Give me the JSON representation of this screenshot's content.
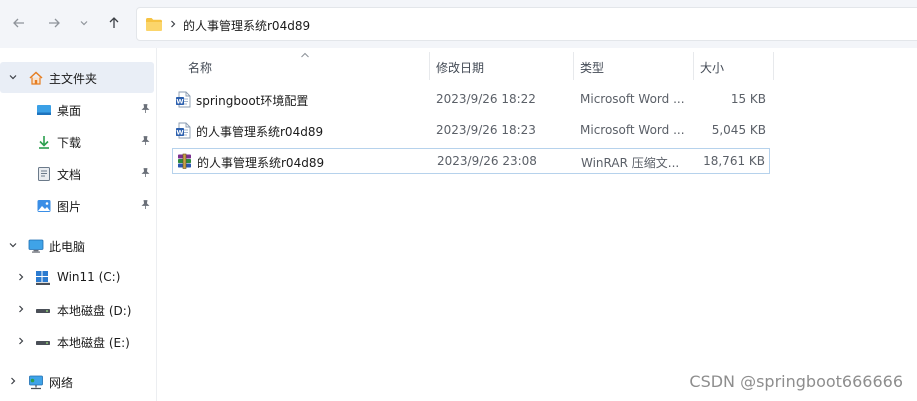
{
  "address": {
    "crumb": "的人事管理系统r04d89"
  },
  "sidebar": {
    "home": {
      "label": "主文件夹"
    },
    "quick": [
      {
        "label": "桌面",
        "icon": "desktop-icon"
      },
      {
        "label": "下载",
        "icon": "download-icon"
      },
      {
        "label": "文档",
        "icon": "documents-icon"
      },
      {
        "label": "图片",
        "icon": "pictures-icon"
      }
    ],
    "pc": {
      "label": "此电脑"
    },
    "drives": [
      {
        "label": "Win11 (C:)"
      },
      {
        "label": "本地磁盘 (D:)"
      },
      {
        "label": "本地磁盘 (E:)"
      }
    ],
    "network": {
      "label": "网络"
    }
  },
  "columns": {
    "name": "名称",
    "date": "修改日期",
    "type": "类型",
    "size": "大小"
  },
  "files": [
    {
      "name": "springboot环境配置",
      "date": "2023/9/26 18:22",
      "type": "Microsoft Word ...",
      "size": "15 KB",
      "icon": "word-document-icon"
    },
    {
      "name": "的人事管理系统r04d89",
      "date": "2023/9/26 18:23",
      "type": "Microsoft Word ...",
      "size": "5,045 KB",
      "icon": "word-document-icon"
    },
    {
      "name": "的人事管理系统r04d89",
      "date": "2023/9/26 23:08",
      "type": "WinRAR 压缩文...",
      "size": "18,761 KB",
      "icon": "winrar-archive-icon"
    }
  ],
  "watermark": "CSDN @springboot666666",
  "colors": {
    "selection": "#e9eef6",
    "selected_border": "#b6d2ec",
    "folder": "#f6c343"
  }
}
